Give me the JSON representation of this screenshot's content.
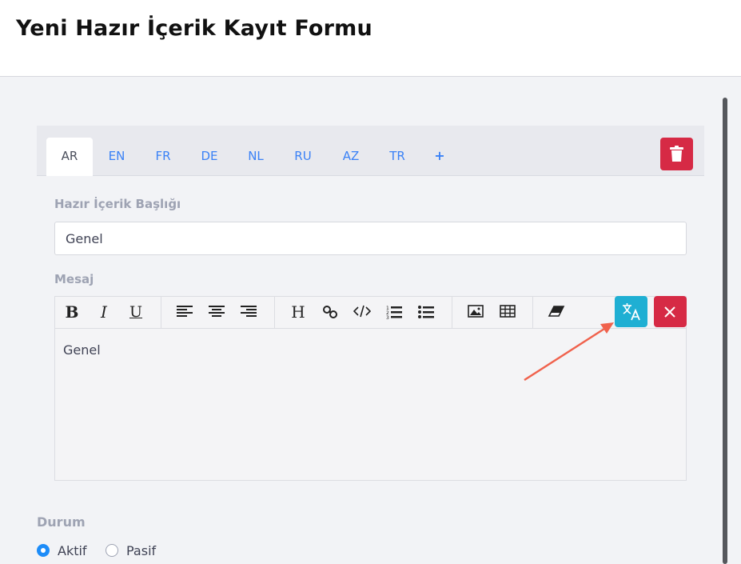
{
  "page": {
    "title": "Yeni Hazır İçerik Kayıt Formu"
  },
  "tabs": [
    {
      "label": "AR",
      "active": true
    },
    {
      "label": "EN"
    },
    {
      "label": "FR"
    },
    {
      "label": "DE"
    },
    {
      "label": "NL"
    },
    {
      "label": "RU"
    },
    {
      "label": "AZ"
    },
    {
      "label": "TR"
    },
    {
      "label": "+"
    }
  ],
  "form": {
    "title_label": "Hazır İçerik Başlığı",
    "title_value": "Genel",
    "message_label": "Mesaj",
    "message_body": "Genel"
  },
  "toolbar": {
    "bold": "B",
    "italic": "I",
    "underline": "U",
    "heading": "H",
    "icons": [
      "align-left-icon",
      "align-center-icon",
      "align-right-icon",
      "link-icon",
      "code-icon",
      "ordered-list-icon",
      "bullet-list-icon",
      "image-icon",
      "table-icon",
      "eraser-icon",
      "translate-icon",
      "close-icon"
    ]
  },
  "status": {
    "label": "Durum",
    "options": [
      {
        "label": "Aktif",
        "selected": true
      },
      {
        "label": "Pasif",
        "selected": false
      }
    ]
  },
  "colors": {
    "accent": "#3b82f6",
    "danger": "#d62a45",
    "translate": "#1fafd3",
    "annotation_arrow": "#f0624d"
  }
}
